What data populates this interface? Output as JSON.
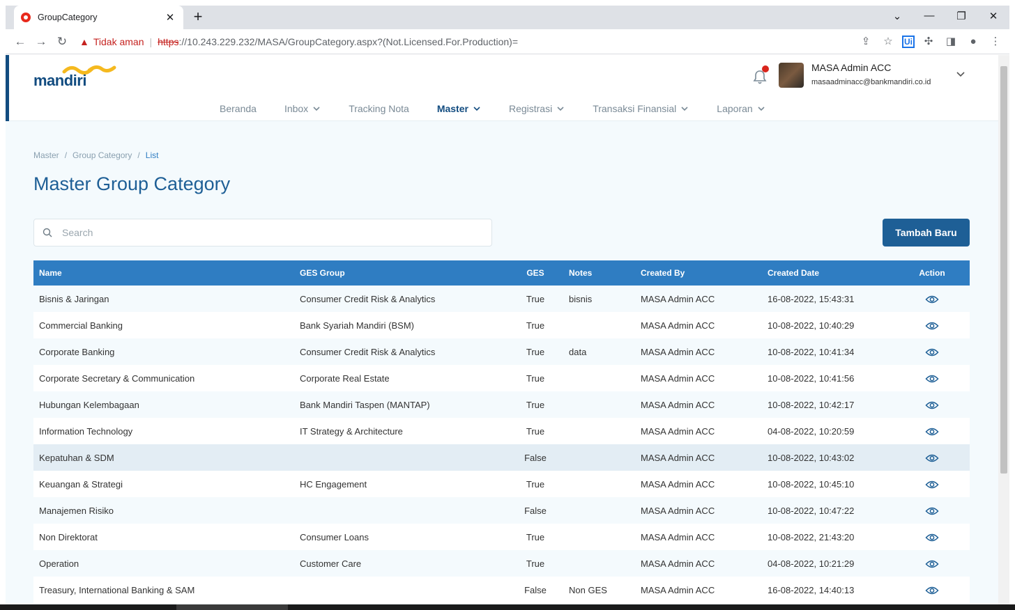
{
  "browser": {
    "tab_title": "GroupCategory",
    "not_secure": "Tidak aman",
    "url_https": "https",
    "url_rest": "://10.243.229.232/MASA/GroupCategory.aspx?(Not.Licensed.For.Production)="
  },
  "header": {
    "logo_text": "mandiri",
    "user_name": "MASA Admin ACC",
    "user_email": "masaadminacc@bankmandiri.co.id"
  },
  "nav": {
    "items": [
      {
        "label": "Beranda",
        "dropdown": false,
        "active": false
      },
      {
        "label": "Inbox",
        "dropdown": true,
        "active": false
      },
      {
        "label": "Tracking Nota",
        "dropdown": false,
        "active": false
      },
      {
        "label": "Master",
        "dropdown": true,
        "active": true
      },
      {
        "label": "Registrasi",
        "dropdown": true,
        "active": false
      },
      {
        "label": "Transaksi Finansial",
        "dropdown": true,
        "active": false
      },
      {
        "label": "Laporan",
        "dropdown": true,
        "active": false
      }
    ]
  },
  "breadcrumb": {
    "items": [
      "Master",
      "Group Category",
      "List"
    ],
    "sep": "/"
  },
  "page": {
    "title": "Master Group Category",
    "search_placeholder": "Search",
    "add_label": "Tambah Baru"
  },
  "table": {
    "columns": [
      "Name",
      "GES Group",
      "GES",
      "Notes",
      "Created By",
      "Created Date",
      "Action"
    ],
    "rows": [
      {
        "name": "Bisnis & Jaringan",
        "ges_group": "Consumer Credit Risk & Analytics",
        "ges": "True",
        "notes": "bisnis",
        "created_by": "MASA Admin ACC",
        "created_date": "16-08-2022, 15:43:31"
      },
      {
        "name": "Commercial Banking",
        "ges_group": "Bank Syariah Mandiri (BSM)",
        "ges": "True",
        "notes": "",
        "created_by": "MASA Admin ACC",
        "created_date": "10-08-2022, 10:40:29"
      },
      {
        "name": "Corporate Banking",
        "ges_group": "Consumer Credit Risk & Analytics",
        "ges": "True",
        "notes": "data",
        "created_by": "MASA Admin ACC",
        "created_date": "10-08-2022, 10:41:34"
      },
      {
        "name": "Corporate Secretary & Communication",
        "ges_group": "Corporate Real Estate",
        "ges": "True",
        "notes": "",
        "created_by": "MASA Admin ACC",
        "created_date": "10-08-2022, 10:41:56"
      },
      {
        "name": "Hubungan Kelembagaan",
        "ges_group": "Bank Mandiri Taspen (MANTAP)",
        "ges": "True",
        "notes": "",
        "created_by": "MASA Admin ACC",
        "created_date": "10-08-2022, 10:42:17"
      },
      {
        "name": "Information Technology",
        "ges_group": "IT Strategy & Architecture",
        "ges": "True",
        "notes": "",
        "created_by": "MASA Admin ACC",
        "created_date": "04-08-2022, 10:20:59"
      },
      {
        "name": "Kepatuhan & SDM",
        "ges_group": "",
        "ges": "False",
        "notes": "",
        "created_by": "MASA Admin ACC",
        "created_date": "10-08-2022, 10:43:02",
        "highlight": true
      },
      {
        "name": "Keuangan & Strategi",
        "ges_group": "HC Engagement",
        "ges": "True",
        "notes": "",
        "created_by": "MASA Admin ACC",
        "created_date": "10-08-2022, 10:45:10"
      },
      {
        "name": "Manajemen Risiko",
        "ges_group": "",
        "ges": "False",
        "notes": "",
        "created_by": "MASA Admin ACC",
        "created_date": "10-08-2022, 10:47:22"
      },
      {
        "name": "Non Direktorat",
        "ges_group": "Consumer Loans",
        "ges": "True",
        "notes": "",
        "created_by": "MASA Admin ACC",
        "created_date": "10-08-2022, 21:43:20"
      },
      {
        "name": "Operation",
        "ges_group": "Customer Care",
        "ges": "True",
        "notes": "",
        "created_by": "MASA Admin ACC",
        "created_date": "04-08-2022, 10:21:29"
      },
      {
        "name": "Treasury, International Banking & SAM",
        "ges_group": "",
        "ges": "False",
        "notes": "Non GES",
        "created_by": "MASA Admin ACC",
        "created_date": "16-08-2022, 14:40:13"
      }
    ]
  },
  "colors": {
    "brand": "#124c80",
    "table_header": "#2f7dc2",
    "accent_yellow": "#f5b91f",
    "alert": "#d9251c"
  },
  "icons": {
    "view": "eye-icon",
    "search": "search-icon",
    "notification": "bell-icon"
  }
}
